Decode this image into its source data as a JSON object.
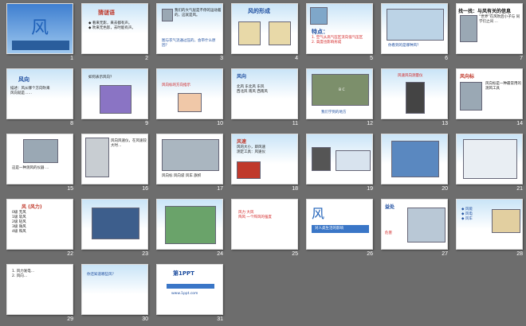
{
  "slides": [
    {
      "num": "1",
      "title": "风",
      "style": "sky"
    },
    {
      "num": "2",
      "title": "猜谜语",
      "text": "◆ 看来无影，来去都有声。\n◆ 吹来无色影，去时能有声。",
      "style": "blue"
    },
    {
      "num": "3",
      "title": "",
      "text": "我们的大气层是不停的运动着的，这就是风。",
      "foot": "图与衣气流通过压的，会带什么原因？",
      "style": "blue"
    },
    {
      "num": "4",
      "title": "风的形成",
      "style": "blue"
    },
    {
      "num": "5",
      "title": "特点：",
      "text": "1. 空气从高气压区流向低气压区\n2. 高度也影响形成",
      "style": "blue"
    },
    {
      "num": "6",
      "title": "",
      "foot": "你看到的是哪种风？",
      "style": "blue"
    },
    {
      "num": "7",
      "title": "找一找：与风有关的信息",
      "text": "“世界”在风吹后小子与 同学们之间 …",
      "style": "white"
    },
    {
      "num": "8",
      "title": "风向",
      "text": "描述：风从哪个方向吹来\n风向就是……",
      "style": "blue"
    },
    {
      "num": "9",
      "title": "",
      "text": "如何表示风向？",
      "style": "blue"
    },
    {
      "num": "10",
      "title": "",
      "text": "风向标的方向指示",
      "style": "blue"
    },
    {
      "num": "11",
      "title": "风向",
      "text": "北风  东北风  东风\n西北风  南风  西南风",
      "style": "blue"
    },
    {
      "num": "12",
      "title": "",
      "text": "B  C",
      "foot": "我们学到的地方",
      "style": "blue"
    },
    {
      "num": "13",
      "title": "",
      "foot": "风速风向测量仪",
      "style": "blue"
    },
    {
      "num": "14",
      "title": "风向标",
      "text": "风向标是一种最常用的测风工具",
      "style": "white"
    },
    {
      "num": "15",
      "title": "",
      "text": "这是一种测风的仪器 …",
      "style": "white"
    },
    {
      "num": "16",
      "title": "",
      "text": "风向风速仪，在风速较大时…",
      "style": "white"
    },
    {
      "num": "17",
      "title": "",
      "text": "风向标 风向袋 风车 旗帜",
      "style": "white"
    },
    {
      "num": "18",
      "title": "风速",
      "text": "风的大小，即风速\n测定工具：风速仪",
      "style": "blue"
    },
    {
      "num": "19",
      "title": "",
      "style": "blue"
    },
    {
      "num": "20",
      "title": "",
      "style": "blue"
    },
    {
      "num": "21",
      "title": "风 (风力)",
      "text": "0级  无风\n1级  软风\n2级  轻风\n3级  微风\n4级  和风",
      "style": "white"
    },
    {
      "num": "22",
      "title": "",
      "style": "blue"
    },
    {
      "num": "23",
      "title": "",
      "style": "blue"
    },
    {
      "num": "24",
      "title": "",
      "text": "风力  大风\n阵风  一个阵风的强度",
      "style": "white"
    },
    {
      "num": "25",
      "title": "风",
      "text": "对人类生活的影响",
      "style": "white"
    },
    {
      "num": "26",
      "title": "益处",
      "text": "危害",
      "style": "white"
    },
    {
      "num": "27",
      "title": "",
      "text": "◆ 风能\n◆ 风电\n◆ 风车",
      "style": "blue"
    },
    {
      "num": "28",
      "title": "",
      "text": "1. 风力发电…\n2. 风向…",
      "style": "white"
    },
    {
      "num": "29",
      "title": "",
      "text": "你还知道哪些风？",
      "style": "blue"
    },
    {
      "num": "30",
      "title": "第1PPT",
      "text": "www.1ppt.com",
      "style": "white"
    }
  ],
  "colors": {
    "background": "#6d6d6d",
    "accent": "#1f4fa0",
    "title_red": "#c0392b"
  }
}
